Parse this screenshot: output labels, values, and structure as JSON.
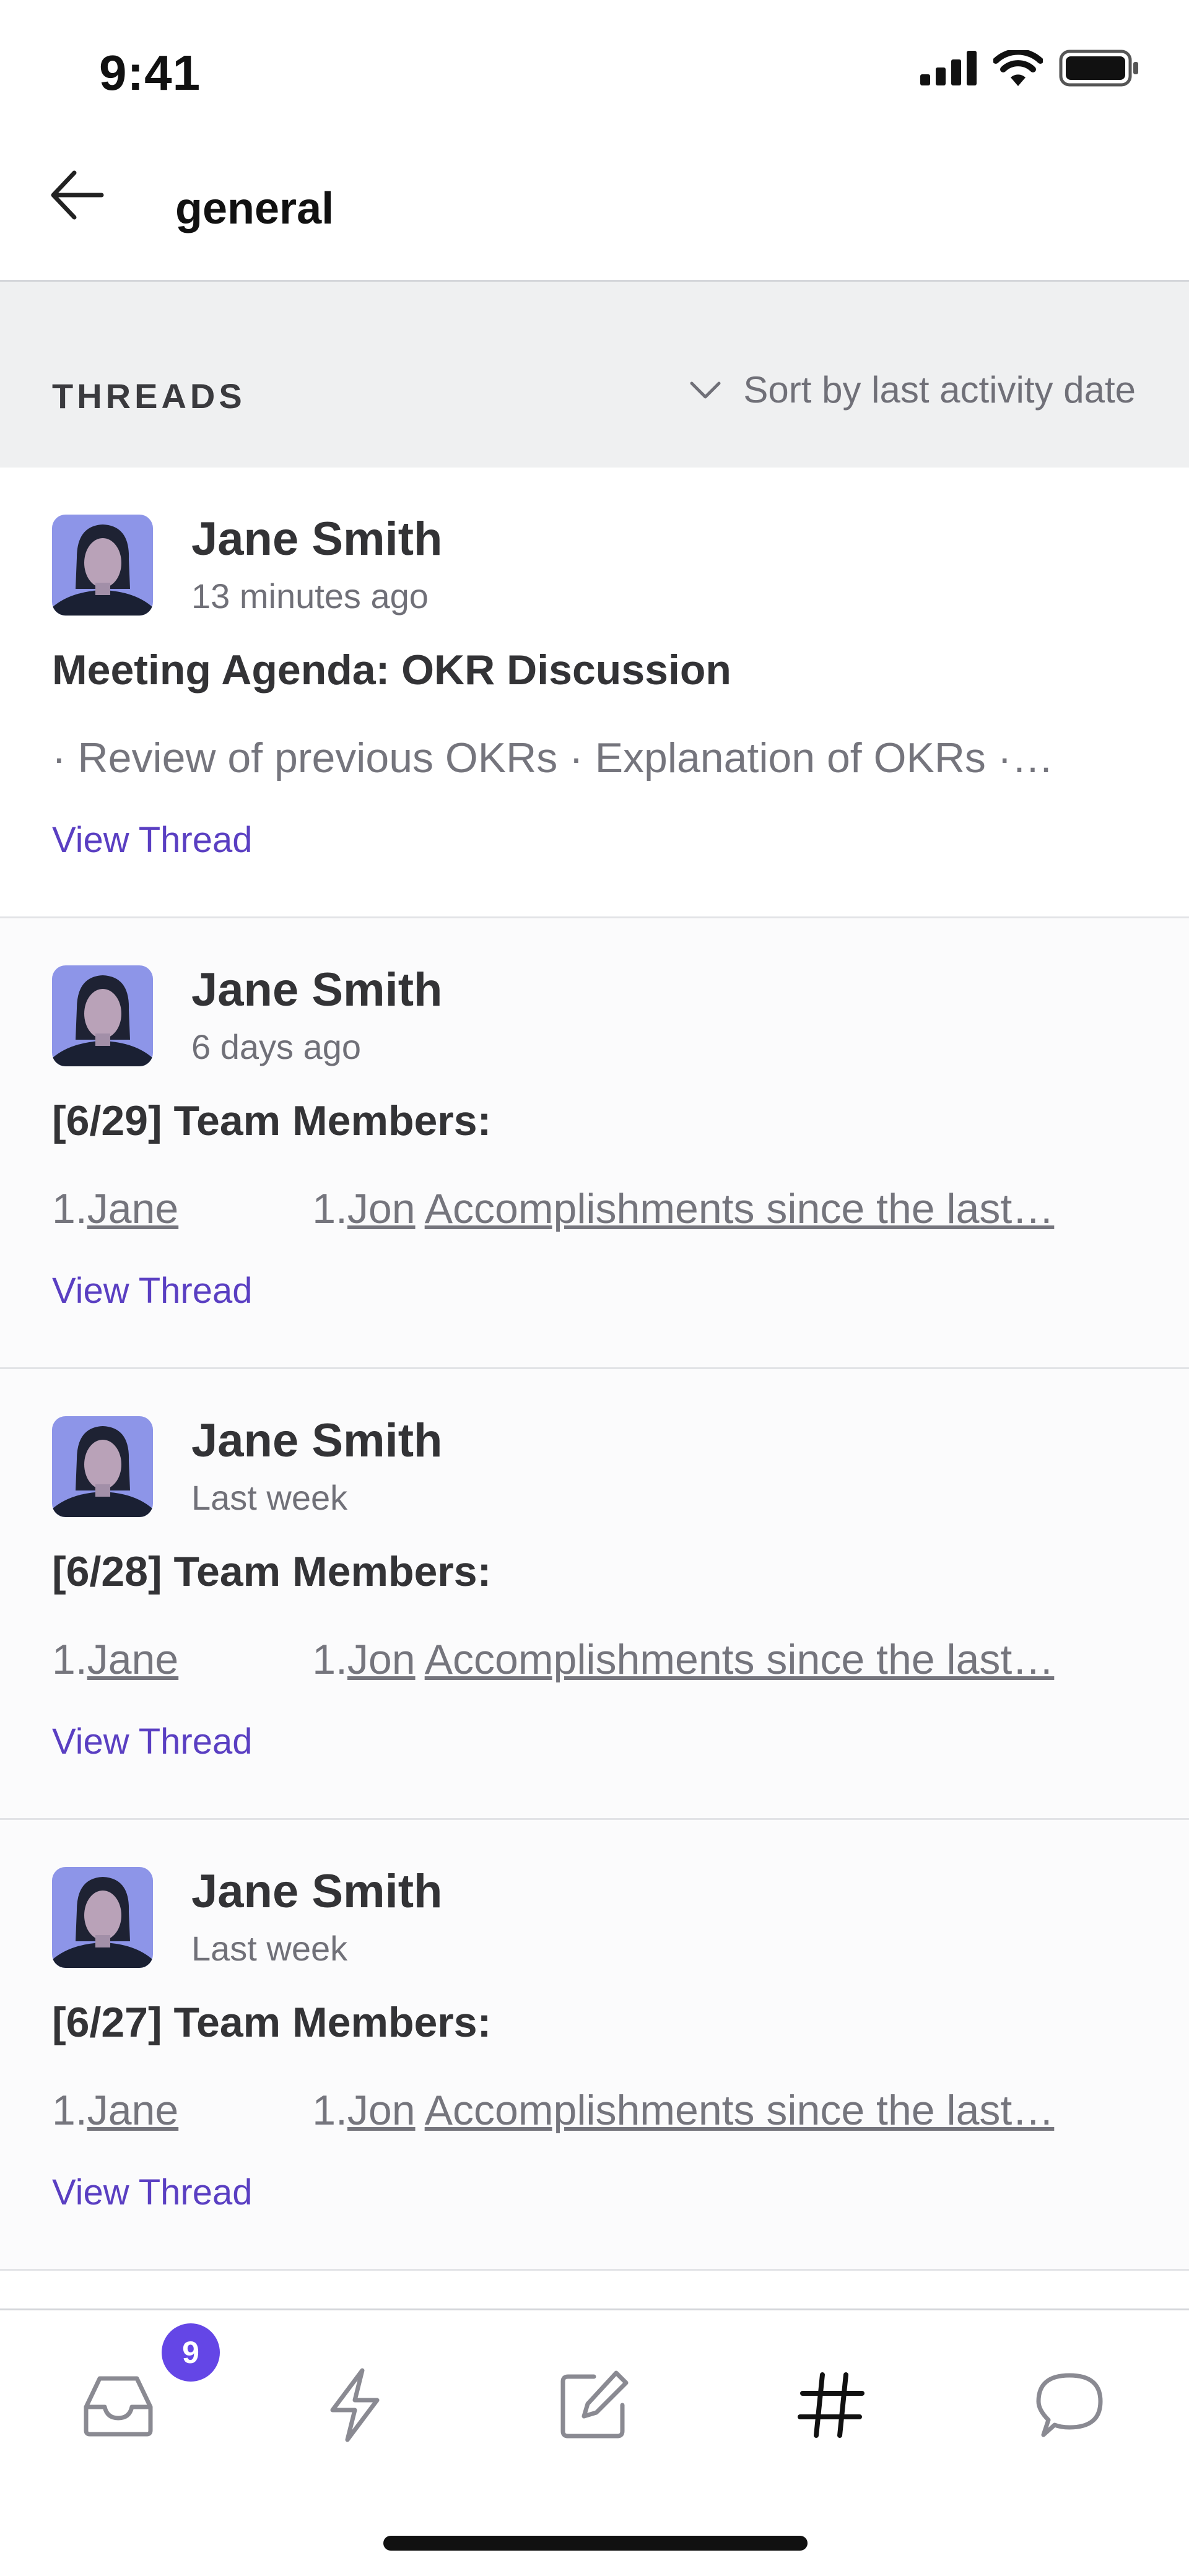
{
  "status_bar": {
    "time": "9:41"
  },
  "header": {
    "channel": "general"
  },
  "threads_header": {
    "label": "THREADS",
    "sort_label": "Sort by last activity date"
  },
  "threads": [
    {
      "author": "Jane Smith",
      "time": "13 minutes ago",
      "title": "Meeting Agenda: OKR Discussion",
      "preview": "· Review of previous OKRs  · Explanation of OKRs  ·…",
      "link": "View Thread"
    },
    {
      "author": "Jane Smith",
      "time": "6 days ago",
      "title": "[6/29] Team Members:",
      "preview_parts": {
        "n1": "1.",
        "p1": "Jane",
        "n2": "1.",
        "p2": "Jon",
        "rest": "Accomplishments since the last…"
      },
      "link": "View Thread"
    },
    {
      "author": "Jane Smith",
      "time": "Last week",
      "title": "[6/28] Team Members:",
      "preview_parts": {
        "n1": "1.",
        "p1": "Jane",
        "n2": "1.",
        "p2": "Jon",
        "rest": "Accomplishments since the last…"
      },
      "link": "View Thread"
    },
    {
      "author": "Jane Smith",
      "time": "Last week",
      "title": "[6/27] Team Members:",
      "preview_parts": {
        "n1": "1.",
        "p1": "Jane",
        "n2": "1.",
        "p2": "Jon",
        "rest": "Accomplishments since the last…"
      },
      "link": "View Thread"
    }
  ],
  "tab_bar": {
    "inbox_badge": "9",
    "tabs": [
      "inbox-icon",
      "lightning-icon",
      "compose-icon",
      "hash-icon",
      "chat-bubble-icon"
    ],
    "active_tab": "hash-icon"
  },
  "colors": {
    "accent": "#6446e6",
    "link": "#5a3fc2",
    "section_bg": "#eff0f1"
  }
}
